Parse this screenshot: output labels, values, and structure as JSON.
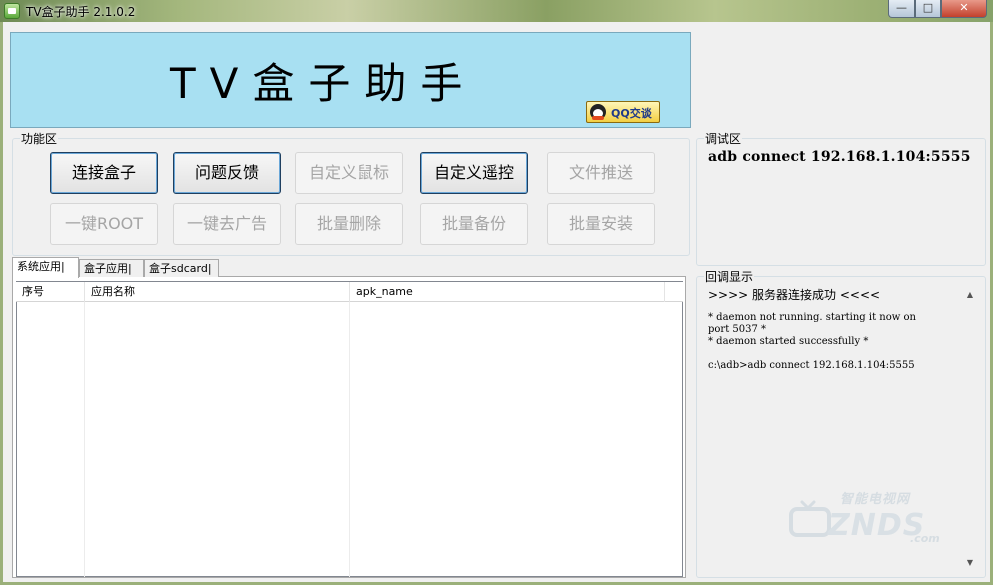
{
  "window": {
    "title": "TV盒子助手 2.1.0.2",
    "controls": {
      "minimize": "—",
      "maximize": "□",
      "close": "✕"
    }
  },
  "banner": {
    "title": "TV盒子助手",
    "qq_button": "QQ交谈",
    "background_color": "#a8e0f2"
  },
  "function_area": {
    "legend": "功能区",
    "buttons": [
      {
        "label": "连接盒子",
        "enabled": true
      },
      {
        "label": "问题反馈",
        "enabled": true
      },
      {
        "label": "自定义鼠标",
        "enabled": false
      },
      {
        "label": "自定义遥控",
        "enabled": true
      },
      {
        "label": "文件推送",
        "enabled": false
      },
      {
        "label": "一键ROOT",
        "enabled": false
      },
      {
        "label": "一键去广告",
        "enabled": false
      },
      {
        "label": "批量删除",
        "enabled": false
      },
      {
        "label": "批量备份",
        "enabled": false
      },
      {
        "label": "批量安装",
        "enabled": false
      }
    ]
  },
  "debug_area": {
    "legend": "调试区",
    "text": "adb connect 192.168.1.104:5555"
  },
  "echo_area": {
    "legend": "回调显示",
    "header": ">>>> 服务器连接成功 <<<<",
    "log_lines": [
      "* daemon not running. starting it now on",
      "port 5037 *",
      "* daemon started successfully *",
      "c:\\adb>adb connect 192.168.1.104:5555"
    ]
  },
  "tabs": [
    {
      "label": "系统应用|",
      "active": true
    },
    {
      "label": "盒子应用|",
      "active": false
    },
    {
      "label": "盒子sdcard|",
      "active": false
    }
  ],
  "table": {
    "columns": [
      "序号",
      "应用名称",
      "apk_name"
    ],
    "rows": []
  },
  "watermark": {
    "cn": "智能电视网",
    "en": "ZNDS",
    "suffix": ".com"
  }
}
